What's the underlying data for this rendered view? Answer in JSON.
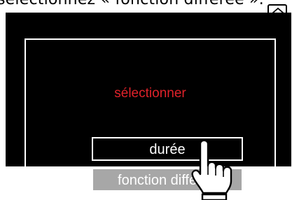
{
  "caption": "sélectionnez « fonction différée ».",
  "screen": {
    "title": "sélectionner",
    "options": [
      {
        "label": "durée",
        "selected": false
      },
      {
        "label": "fonction différée",
        "selected": true
      }
    ]
  },
  "icons": {
    "home": "home-icon",
    "pointer": "pointing-hand-icon"
  },
  "colors": {
    "screen_bg": "#000000",
    "title": "#e0222a",
    "selected_bg": "#a7a7a7"
  }
}
